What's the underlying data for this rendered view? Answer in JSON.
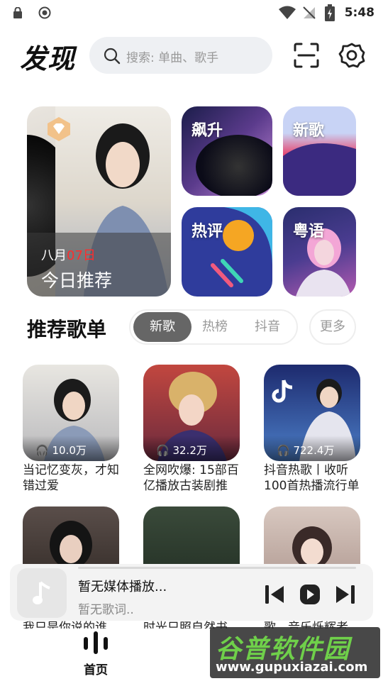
{
  "status_bar": {
    "time": "5:48"
  },
  "header": {
    "title": "发现",
    "search_placeholder": "搜索: 单曲、歌手"
  },
  "featured": {
    "date_month": "八月",
    "date_day": "07日",
    "title": "今日推荐"
  },
  "tiles": [
    {
      "label": "飙升"
    },
    {
      "label": "新歌"
    },
    {
      "label": "热评"
    },
    {
      "label": "粤语"
    }
  ],
  "playlists_section": {
    "title": "推荐歌单",
    "tabs": [
      "新歌",
      "热榜",
      "抖音"
    ],
    "active_tab": "新歌",
    "more": "更多"
  },
  "playlists": [
    {
      "count": "10.0万",
      "title": "当记忆变灰，才知错过爱"
    },
    {
      "count": "32.2万",
      "title": "全网吹爆: 15部百亿播放古装剧推"
    },
    {
      "count": "722.4万",
      "title": "抖音热歌丨收听100首热播流行单"
    },
    {
      "count": "",
      "title": "我只是你说的谁"
    },
    {
      "count": "",
      "title": "时光只照自然书"
    },
    {
      "count": "",
      "title": "歌，音乐烁辉者"
    }
  ],
  "player": {
    "title": "暂无媒体播放...",
    "lyric": "暂无歌词.."
  },
  "bottom_nav": {
    "home": "首页"
  },
  "watermark": {
    "line1": "谷普软件园",
    "line2": "www.gupuxiazai.com"
  }
}
